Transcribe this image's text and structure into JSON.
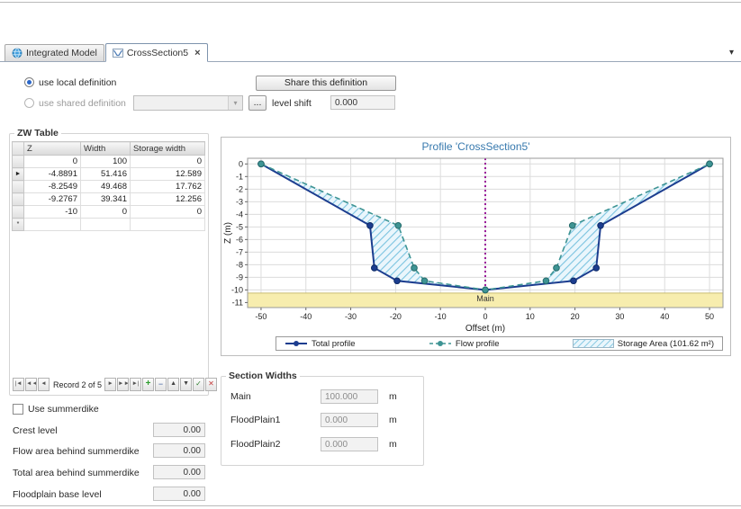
{
  "tabs": {
    "items": [
      {
        "label": "Integrated Model"
      },
      {
        "label": "CrossSection5"
      }
    ]
  },
  "icons": {
    "close_tab": "×",
    "tab_list_chevron": "▾",
    "combo_arrow": "▾"
  },
  "definition": {
    "use_local_label": "use local definition",
    "use_shared_label": "use shared definition",
    "share_button_label": "Share this definition",
    "browse_button_label": "...",
    "shared_combo_value": "",
    "level_shift_label": "level shift",
    "level_shift_value": "0.000"
  },
  "zw_table": {
    "group_title": "ZW Table",
    "columns": [
      "Z",
      "Width",
      "Storage width"
    ],
    "rows": [
      {
        "sel": "",
        "z": "0",
        "width": "100",
        "storage": "0"
      },
      {
        "sel": "►",
        "z": "-4.8891",
        "width": "51.416",
        "storage": "12.589"
      },
      {
        "sel": "",
        "z": "-8.2549",
        "width": "49.468",
        "storage": "17.762"
      },
      {
        "sel": "",
        "z": "-9.2767",
        "width": "39.341",
        "storage": "12.256"
      },
      {
        "sel": "",
        "z": "-10",
        "width": "0",
        "storage": "0"
      },
      {
        "sel": "*",
        "z": "",
        "width": "",
        "storage": ""
      }
    ],
    "navigator": {
      "first": "|◄",
      "prev_page": "◄◄",
      "prev": "◄",
      "record_label": "Record 2 of 5",
      "next": "►",
      "next_page": "►►",
      "last": "►|",
      "add": "+",
      "delete": "−",
      "up": "▲",
      "down": "▼",
      "ok": "✓",
      "cancel": "✕"
    }
  },
  "summerdike": {
    "checkbox_label": "Use summerdike",
    "fields": [
      {
        "label": "Crest level",
        "value": "0.00"
      },
      {
        "label": "Flow area behind summerdike",
        "value": "0.00"
      },
      {
        "label": "Total area behind summerdike",
        "value": "0.00"
      },
      {
        "label": "Floodplain base level",
        "value": "0.00"
      }
    ]
  },
  "section_widths": {
    "group_title": "Section Widths",
    "fields": [
      {
        "label": "Main",
        "value": "100.000",
        "unit": "m"
      },
      {
        "label": "FloodPlain1",
        "value": "0.000",
        "unit": "m"
      },
      {
        "label": "FloodPlain2",
        "value": "0.000",
        "unit": "m"
      }
    ]
  },
  "chart_data": {
    "type": "line",
    "title": "Profile 'CrossSection5'",
    "xlabel": "Offset (m)",
    "ylabel": "Z (m)",
    "xlim": [
      -53,
      53
    ],
    "ylim": [
      -11.4,
      0.45
    ],
    "xticks": [
      -50,
      -40,
      -30,
      -20,
      -10,
      0,
      10,
      20,
      30,
      40,
      50
    ],
    "yticks": [
      0,
      -1,
      -2,
      -3,
      -4,
      -5,
      -6,
      -7,
      -8,
      -9,
      -10,
      -11
    ],
    "series": [
      {
        "name": "Total profile",
        "color": "#1c3d8f",
        "edge": "#0d2a66",
        "style": "solid",
        "points": [
          [
            -50,
            0
          ],
          [
            -25.708,
            -4.8891
          ],
          [
            -24.734,
            -8.2549
          ],
          [
            -19.671,
            -9.2767
          ],
          [
            0,
            -10
          ],
          [
            19.671,
            -9.2767
          ],
          [
            24.734,
            -8.2549
          ],
          [
            25.708,
            -4.8891
          ],
          [
            50,
            0
          ]
        ]
      },
      {
        "name": "Flow profile",
        "color": "#3e9494",
        "edge": "#256b6b",
        "style": "dashed",
        "points": [
          [
            -50,
            0
          ],
          [
            -19.414,
            -4.8891
          ],
          [
            -15.853,
            -8.2549
          ],
          [
            -13.542,
            -9.2767
          ],
          [
            0,
            -10
          ],
          [
            13.542,
            -9.2767
          ],
          [
            15.853,
            -8.2549
          ],
          [
            19.414,
            -4.8891
          ],
          [
            50,
            0
          ]
        ]
      }
    ],
    "storage_area": {
      "name": "Storage Area (101.62 m²)",
      "hatch_color": "#7cc4e0",
      "bg_color": "#eaf6fc"
    },
    "center_line": {
      "x": 0,
      "color": "#9b1b9b"
    },
    "main_band": {
      "label": "Main",
      "y_top": -10.25,
      "color": "#f7edae",
      "border": "#c9bd70"
    }
  }
}
